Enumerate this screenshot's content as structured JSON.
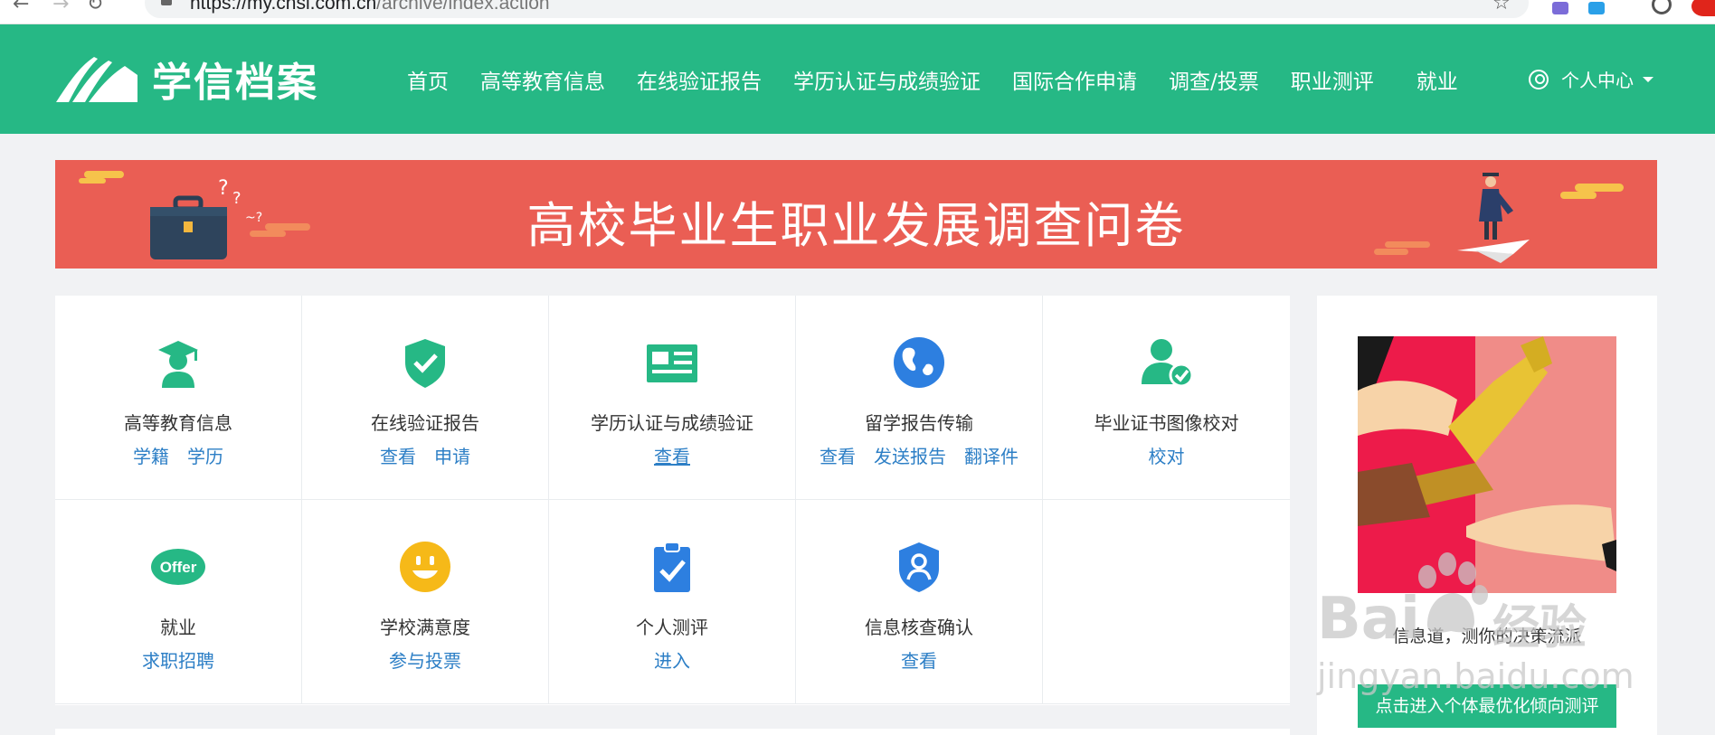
{
  "browser": {
    "url_host": "https://my.chsi.com.cn",
    "url_path": "/archive/index.action",
    "back_icon": "arrow-left-icon",
    "forward_icon": "arrow-right-icon",
    "reload_icon": "reload-icon",
    "star_icon": "star-icon"
  },
  "header": {
    "logo_text": "学信档案",
    "nav": [
      "首页",
      "高等教育信息",
      "在线验证报告",
      "学历认证与成绩验证",
      "国际合作申请",
      "调查/投票",
      "职业测评",
      "就业"
    ],
    "user_label": "个人中心",
    "bg_color": "#26b885"
  },
  "banner": {
    "title": "高校毕业生职业发展调查问卷",
    "bg_color": "#ea5e54"
  },
  "grid": {
    "row1": [
      {
        "icon": "graduate-icon",
        "title": "高等教育信息",
        "links": [
          "学籍",
          "学历"
        ]
      },
      {
        "icon": "shield-check-icon",
        "title": "在线验证报告",
        "links": [
          "查看",
          "申请"
        ]
      },
      {
        "icon": "id-card-icon",
        "title": "学历认证与成绩验证",
        "links": [
          "查看"
        ]
      },
      {
        "icon": "globe-icon",
        "title": "留学报告传输",
        "links": [
          "查看",
          "发送报告",
          "翻译件"
        ]
      },
      {
        "icon": "user-check-icon",
        "title": "毕业证书图像校对",
        "links": [
          "校对"
        ]
      }
    ],
    "row2": [
      {
        "icon": "offer-icon",
        "icon_text": "Offer",
        "title": "就业",
        "links": [
          "求职招聘"
        ]
      },
      {
        "icon": "smiley-icon",
        "title": "学校满意度",
        "links": [
          "参与投票"
        ]
      },
      {
        "icon": "clipboard-check-icon",
        "title": "个人测评",
        "links": [
          "进入"
        ]
      },
      {
        "icon": "user-shield-icon",
        "title": "信息核查确认",
        "links": [
          "查看"
        ]
      }
    ]
  },
  "side": {
    "caption": "信息道，测你的决策流派",
    "button": "点击进入个体最优化倾向测评"
  },
  "watermark": {
    "brand": "Bai",
    "brand_cn": "经验",
    "site": "jingyan.baidu.com"
  }
}
